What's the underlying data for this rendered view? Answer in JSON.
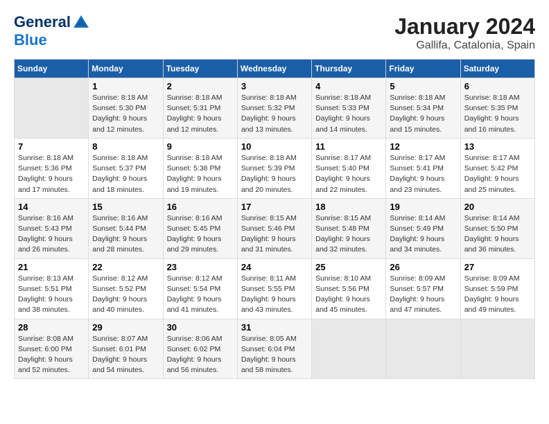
{
  "logo": {
    "line1": "General",
    "line2": "Blue"
  },
  "title": "January 2024",
  "subtitle": "Gallifa, Catalonia, Spain",
  "days_of_week": [
    "Sunday",
    "Monday",
    "Tuesday",
    "Wednesday",
    "Thursday",
    "Friday",
    "Saturday"
  ],
  "weeks": [
    [
      {
        "day": "",
        "sunrise": "",
        "sunset": "",
        "daylight": ""
      },
      {
        "day": "1",
        "sunrise": "Sunrise: 8:18 AM",
        "sunset": "Sunset: 5:30 PM",
        "daylight": "Daylight: 9 hours and 12 minutes."
      },
      {
        "day": "2",
        "sunrise": "Sunrise: 8:18 AM",
        "sunset": "Sunset: 5:31 PM",
        "daylight": "Daylight: 9 hours and 12 minutes."
      },
      {
        "day": "3",
        "sunrise": "Sunrise: 8:18 AM",
        "sunset": "Sunset: 5:32 PM",
        "daylight": "Daylight: 9 hours and 13 minutes."
      },
      {
        "day": "4",
        "sunrise": "Sunrise: 8:18 AM",
        "sunset": "Sunset: 5:33 PM",
        "daylight": "Daylight: 9 hours and 14 minutes."
      },
      {
        "day": "5",
        "sunrise": "Sunrise: 8:18 AM",
        "sunset": "Sunset: 5:34 PM",
        "daylight": "Daylight: 9 hours and 15 minutes."
      },
      {
        "day": "6",
        "sunrise": "Sunrise: 8:18 AM",
        "sunset": "Sunset: 5:35 PM",
        "daylight": "Daylight: 9 hours and 16 minutes."
      }
    ],
    [
      {
        "day": "7",
        "sunrise": "Sunrise: 8:18 AM",
        "sunset": "Sunset: 5:36 PM",
        "daylight": "Daylight: 9 hours and 17 minutes."
      },
      {
        "day": "8",
        "sunrise": "Sunrise: 8:18 AM",
        "sunset": "Sunset: 5:37 PM",
        "daylight": "Daylight: 9 hours and 18 minutes."
      },
      {
        "day": "9",
        "sunrise": "Sunrise: 8:18 AM",
        "sunset": "Sunset: 5:38 PM",
        "daylight": "Daylight: 9 hours and 19 minutes."
      },
      {
        "day": "10",
        "sunrise": "Sunrise: 8:18 AM",
        "sunset": "Sunset: 5:39 PM",
        "daylight": "Daylight: 9 hours and 20 minutes."
      },
      {
        "day": "11",
        "sunrise": "Sunrise: 8:17 AM",
        "sunset": "Sunset: 5:40 PM",
        "daylight": "Daylight: 9 hours and 22 minutes."
      },
      {
        "day": "12",
        "sunrise": "Sunrise: 8:17 AM",
        "sunset": "Sunset: 5:41 PM",
        "daylight": "Daylight: 9 hours and 23 minutes."
      },
      {
        "day": "13",
        "sunrise": "Sunrise: 8:17 AM",
        "sunset": "Sunset: 5:42 PM",
        "daylight": "Daylight: 9 hours and 25 minutes."
      }
    ],
    [
      {
        "day": "14",
        "sunrise": "Sunrise: 8:16 AM",
        "sunset": "Sunset: 5:43 PM",
        "daylight": "Daylight: 9 hours and 26 minutes."
      },
      {
        "day": "15",
        "sunrise": "Sunrise: 8:16 AM",
        "sunset": "Sunset: 5:44 PM",
        "daylight": "Daylight: 9 hours and 28 minutes."
      },
      {
        "day": "16",
        "sunrise": "Sunrise: 8:16 AM",
        "sunset": "Sunset: 5:45 PM",
        "daylight": "Daylight: 9 hours and 29 minutes."
      },
      {
        "day": "17",
        "sunrise": "Sunrise: 8:15 AM",
        "sunset": "Sunset: 5:46 PM",
        "daylight": "Daylight: 9 hours and 31 minutes."
      },
      {
        "day": "18",
        "sunrise": "Sunrise: 8:15 AM",
        "sunset": "Sunset: 5:48 PM",
        "daylight": "Daylight: 9 hours and 32 minutes."
      },
      {
        "day": "19",
        "sunrise": "Sunrise: 8:14 AM",
        "sunset": "Sunset: 5:49 PM",
        "daylight": "Daylight: 9 hours and 34 minutes."
      },
      {
        "day": "20",
        "sunrise": "Sunrise: 8:14 AM",
        "sunset": "Sunset: 5:50 PM",
        "daylight": "Daylight: 9 hours and 36 minutes."
      }
    ],
    [
      {
        "day": "21",
        "sunrise": "Sunrise: 8:13 AM",
        "sunset": "Sunset: 5:51 PM",
        "daylight": "Daylight: 9 hours and 38 minutes."
      },
      {
        "day": "22",
        "sunrise": "Sunrise: 8:12 AM",
        "sunset": "Sunset: 5:52 PM",
        "daylight": "Daylight: 9 hours and 40 minutes."
      },
      {
        "day": "23",
        "sunrise": "Sunrise: 8:12 AM",
        "sunset": "Sunset: 5:54 PM",
        "daylight": "Daylight: 9 hours and 41 minutes."
      },
      {
        "day": "24",
        "sunrise": "Sunrise: 8:11 AM",
        "sunset": "Sunset: 5:55 PM",
        "daylight": "Daylight: 9 hours and 43 minutes."
      },
      {
        "day": "25",
        "sunrise": "Sunrise: 8:10 AM",
        "sunset": "Sunset: 5:56 PM",
        "daylight": "Daylight: 9 hours and 45 minutes."
      },
      {
        "day": "26",
        "sunrise": "Sunrise: 8:09 AM",
        "sunset": "Sunset: 5:57 PM",
        "daylight": "Daylight: 9 hours and 47 minutes."
      },
      {
        "day": "27",
        "sunrise": "Sunrise: 8:09 AM",
        "sunset": "Sunset: 5:59 PM",
        "daylight": "Daylight: 9 hours and 49 minutes."
      }
    ],
    [
      {
        "day": "28",
        "sunrise": "Sunrise: 8:08 AM",
        "sunset": "Sunset: 6:00 PM",
        "daylight": "Daylight: 9 hours and 52 minutes."
      },
      {
        "day": "29",
        "sunrise": "Sunrise: 8:07 AM",
        "sunset": "Sunset: 6:01 PM",
        "daylight": "Daylight: 9 hours and 54 minutes."
      },
      {
        "day": "30",
        "sunrise": "Sunrise: 8:06 AM",
        "sunset": "Sunset: 6:02 PM",
        "daylight": "Daylight: 9 hours and 56 minutes."
      },
      {
        "day": "31",
        "sunrise": "Sunrise: 8:05 AM",
        "sunset": "Sunset: 6:04 PM",
        "daylight": "Daylight: 9 hours and 58 minutes."
      },
      {
        "day": "",
        "sunrise": "",
        "sunset": "",
        "daylight": ""
      },
      {
        "day": "",
        "sunrise": "",
        "sunset": "",
        "daylight": ""
      },
      {
        "day": "",
        "sunrise": "",
        "sunset": "",
        "daylight": ""
      }
    ]
  ]
}
